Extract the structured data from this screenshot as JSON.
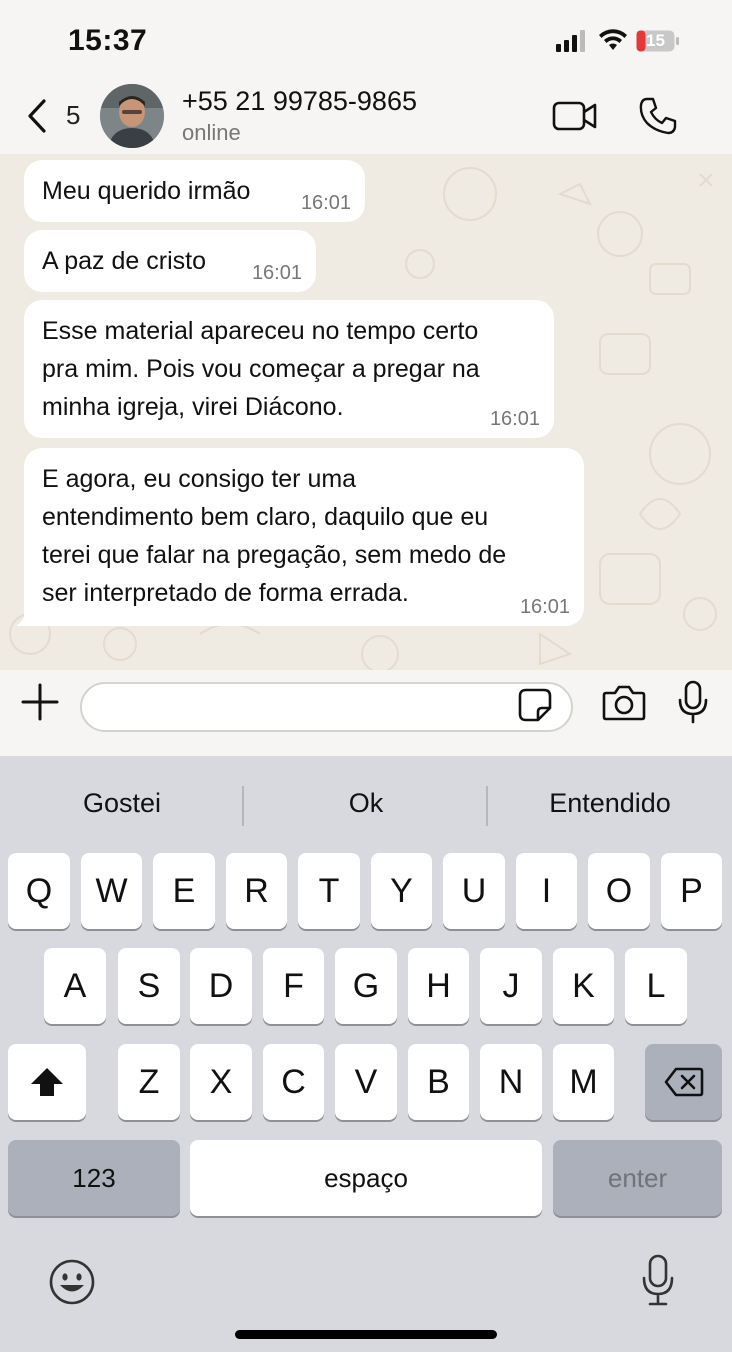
{
  "status_bar": {
    "time": "15:37",
    "battery": "15"
  },
  "header": {
    "unread_count": "5",
    "contact_name": "+55 21 99785-9865",
    "contact_status": "online"
  },
  "messages": [
    {
      "text": "Meu querido irmão",
      "time": "16:01"
    },
    {
      "text": "A paz de cristo",
      "time": "16:01"
    },
    {
      "lines": [
        "Esse material apareceu no tempo certo",
        "pra mim. Pois vou começar a pregar na",
        "minha igreja, virei Diácono."
      ],
      "time": "16:01"
    },
    {
      "lines": [
        "E agora, eu consigo ter uma",
        "entendimento bem claro, daquilo que eu",
        "terei que falar na pregação, sem medo de",
        "ser interpretado de forma errada."
      ],
      "time": "16:01"
    }
  ],
  "composer": {
    "input_value": ""
  },
  "keyboard": {
    "suggestions": [
      "Gostei",
      "Ok",
      "Entendido"
    ],
    "row1": [
      "Q",
      "W",
      "E",
      "R",
      "T",
      "Y",
      "U",
      "I",
      "O",
      "P"
    ],
    "row2": [
      "A",
      "S",
      "D",
      "F",
      "G",
      "H",
      "J",
      "K",
      "L"
    ],
    "row3": [
      "Z",
      "X",
      "C",
      "V",
      "B",
      "N",
      "M"
    ],
    "numbers_label": "123",
    "space_label": "espaço",
    "enter_label": "enter"
  },
  "icons": {
    "signal": "signal-icon",
    "wifi": "wifi-icon",
    "battery": "battery-icon",
    "back": "chevron-left-icon",
    "video": "video-call-icon",
    "phone": "phone-icon",
    "plus": "plus-icon",
    "sticker": "sticker-icon",
    "camera": "camera-icon",
    "mic": "microphone-icon",
    "shift": "shift-icon",
    "backspace": "backspace-icon",
    "emoji": "emoji-icon"
  },
  "colors": {
    "bubble": "#ffffff",
    "chat_bg": "#efeae2",
    "keyboard_bg": "#d8d9de",
    "battery_low": "#e5383b"
  }
}
